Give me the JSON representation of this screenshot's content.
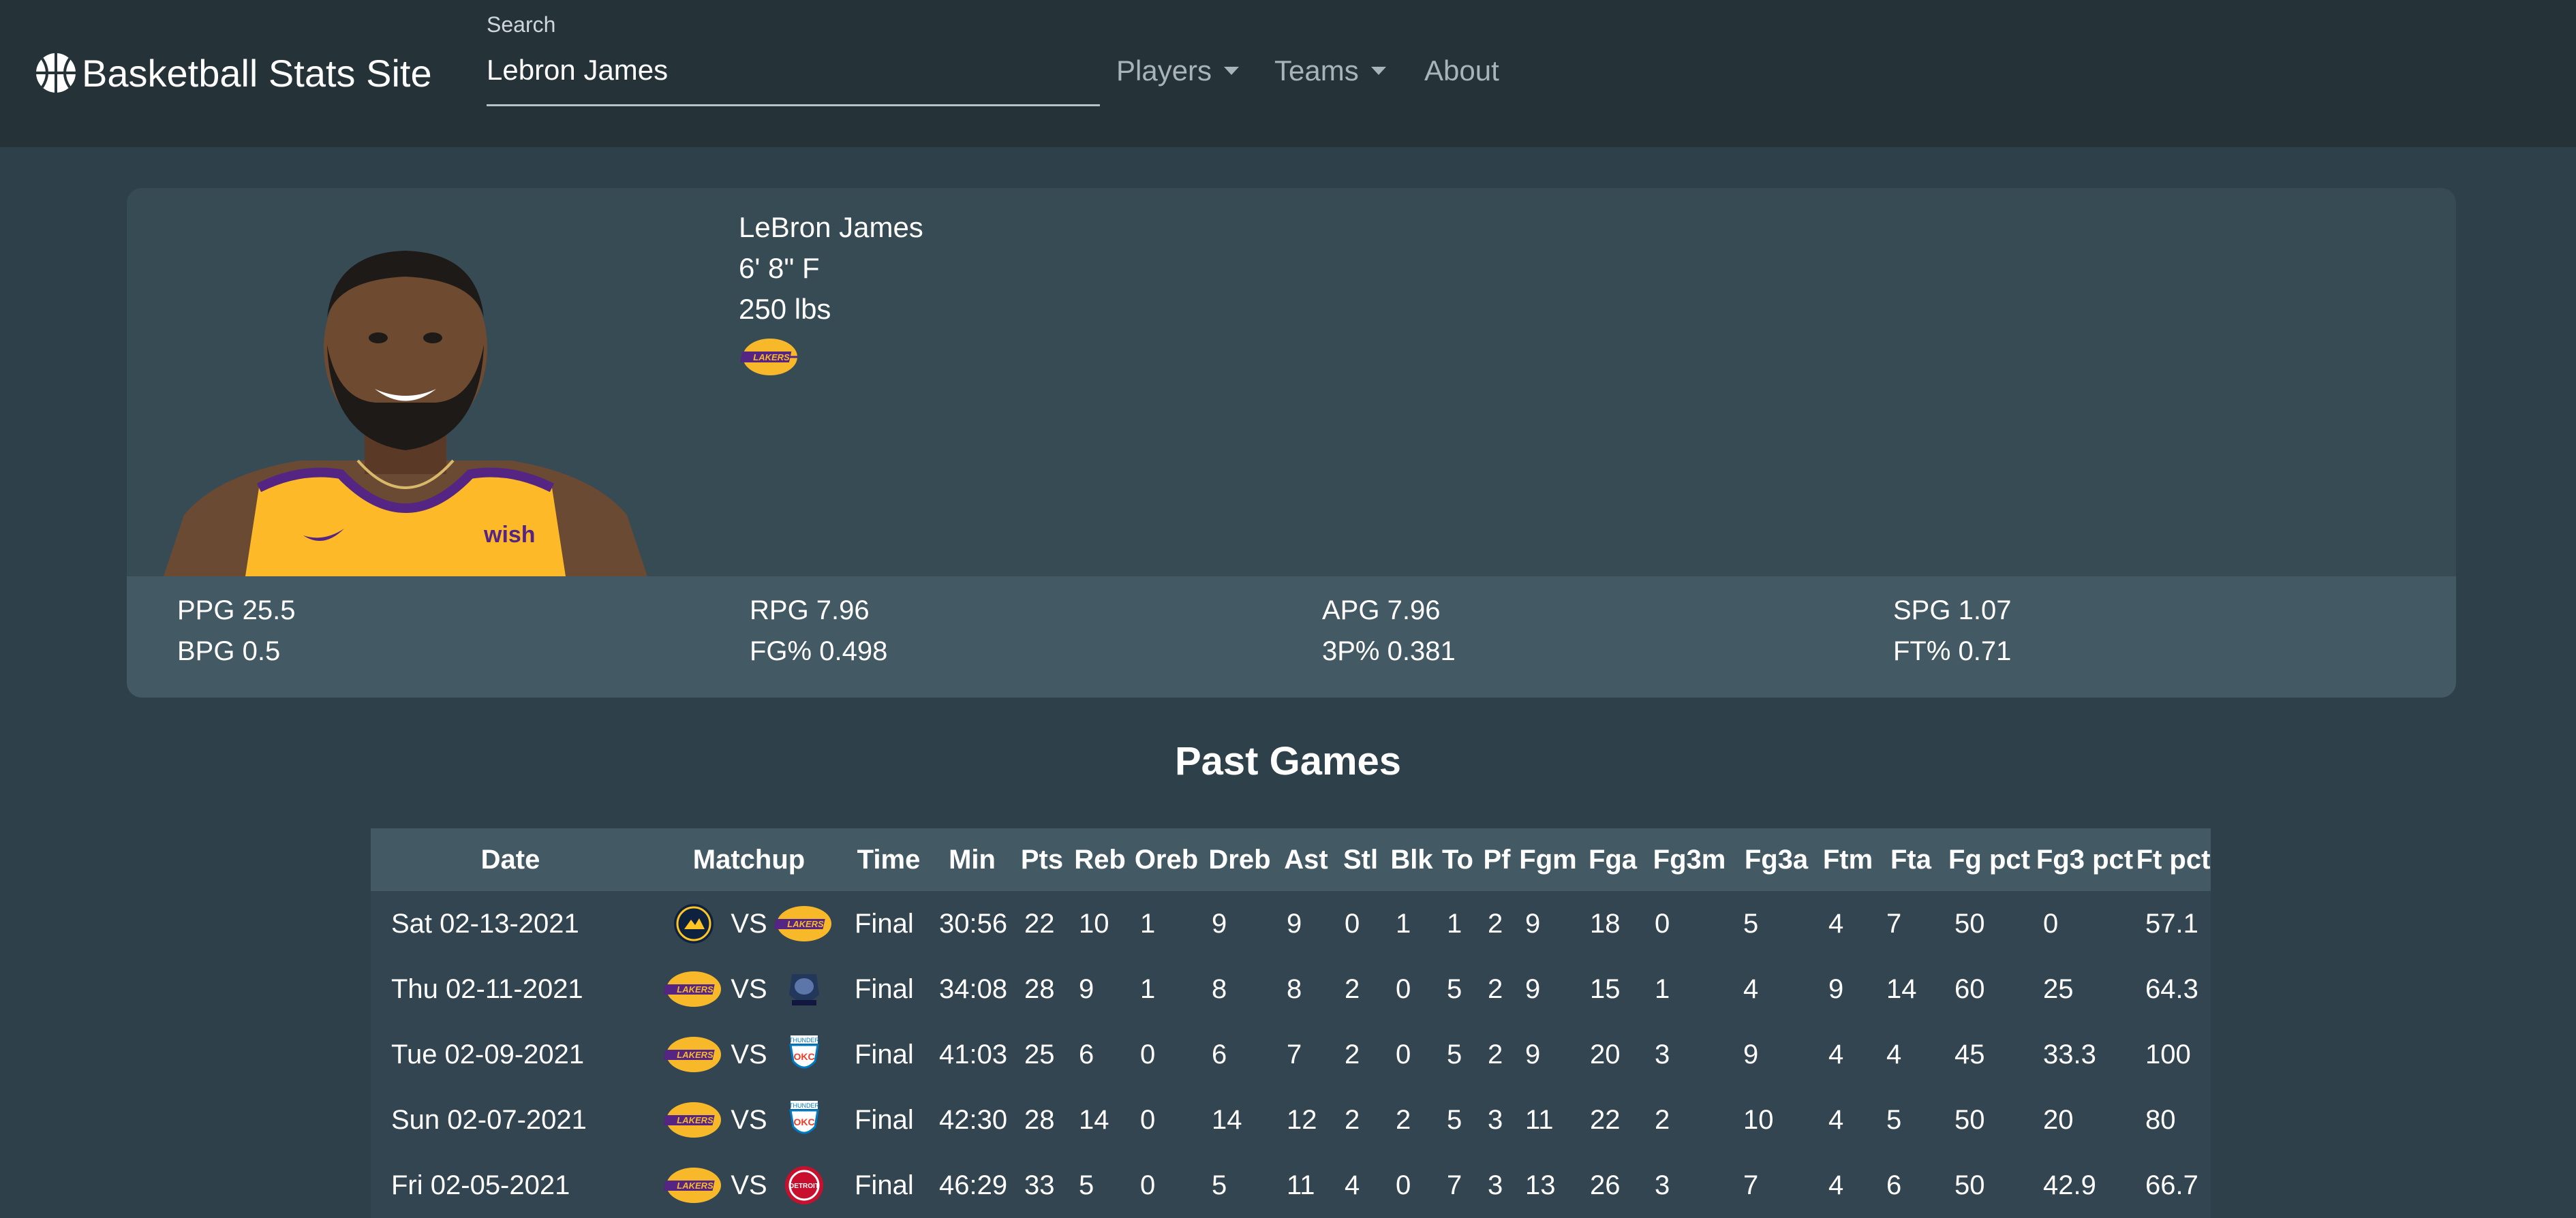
{
  "navbar": {
    "brand": "Basketball Stats Site",
    "search_label": "Search",
    "search_value": "Lebron James",
    "menu": [
      {
        "label": "Players",
        "dropdown": true
      },
      {
        "label": "Teams",
        "dropdown": true
      },
      {
        "label": "About",
        "dropdown": false
      }
    ]
  },
  "player": {
    "name": "LeBron James",
    "height_position": "6' 8\" F",
    "weight": "250 lbs",
    "team_logo_icon": "lakers-logo-icon",
    "photo_icon": "player-headshot"
  },
  "season_stats": {
    "ppg": "PPG 25.5",
    "rpg": "RPG 7.96",
    "apg": "APG 7.96",
    "spg": "SPG 1.07",
    "bpg": "BPG 0.5",
    "fg_pct": "FG% 0.498",
    "three_pct": "3P% 0.381",
    "ft_pct": "FT% 0.71"
  },
  "past_games": {
    "title": "Past Games",
    "columns": [
      "Date",
      "Matchup",
      "Time",
      "Min",
      "Pts",
      "Reb",
      "Oreb",
      "Dreb",
      "Ast",
      "Stl",
      "Blk",
      "To",
      "Pf",
      "Fgm",
      "Fga",
      "Fg3m",
      "Fg3a",
      "Ftm",
      "Fta",
      "Fg pct",
      "Fg3 pct",
      "Ft pct"
    ],
    "vs_label": "VS",
    "rows": [
      {
        "date": "Sat 02-13-2021",
        "home": "nuggets",
        "away": "lakers",
        "cells": [
          "Final",
          "30:56",
          "22",
          "10",
          "1",
          "9",
          "9",
          "0",
          "1",
          "1",
          "2",
          "9",
          "18",
          "0",
          "5",
          "4",
          "7",
          "50",
          "0",
          "57.1"
        ]
      },
      {
        "date": "Thu 02-11-2021",
        "home": "lakers",
        "away": "grizzlies",
        "cells": [
          "Final",
          "34:08",
          "28",
          "9",
          "1",
          "8",
          "8",
          "2",
          "0",
          "5",
          "2",
          "9",
          "15",
          "1",
          "4",
          "9",
          "14",
          "60",
          "25",
          "64.3"
        ]
      },
      {
        "date": "Tue 02-09-2021",
        "home": "lakers",
        "away": "thunder",
        "cells": [
          "Final",
          "41:03",
          "25",
          "6",
          "0",
          "6",
          "7",
          "2",
          "0",
          "5",
          "2",
          "9",
          "20",
          "3",
          "9",
          "4",
          "4",
          "45",
          "33.3",
          "100"
        ]
      },
      {
        "date": "Sun 02-07-2021",
        "home": "lakers",
        "away": "thunder",
        "cells": [
          "Final",
          "42:30",
          "28",
          "14",
          "0",
          "14",
          "12",
          "2",
          "2",
          "5",
          "3",
          "11",
          "22",
          "2",
          "10",
          "4",
          "5",
          "50",
          "20",
          "80"
        ]
      },
      {
        "date": "Fri 02-05-2021",
        "home": "lakers",
        "away": "pistons",
        "cells": [
          "Final",
          "46:29",
          "33",
          "5",
          "0",
          "5",
          "11",
          "4",
          "0",
          "7",
          "3",
          "13",
          "26",
          "3",
          "7",
          "4",
          "6",
          "50",
          "42.9",
          "66.7"
        ]
      }
    ]
  },
  "colors": {
    "navbar_bg": "#253238",
    "page_bg": "#2e4049",
    "card_bg": "#374b55",
    "stats_band_bg": "#435a65",
    "lakers_gold": "#f7b92a",
    "lakers_purple": "#552583"
  }
}
